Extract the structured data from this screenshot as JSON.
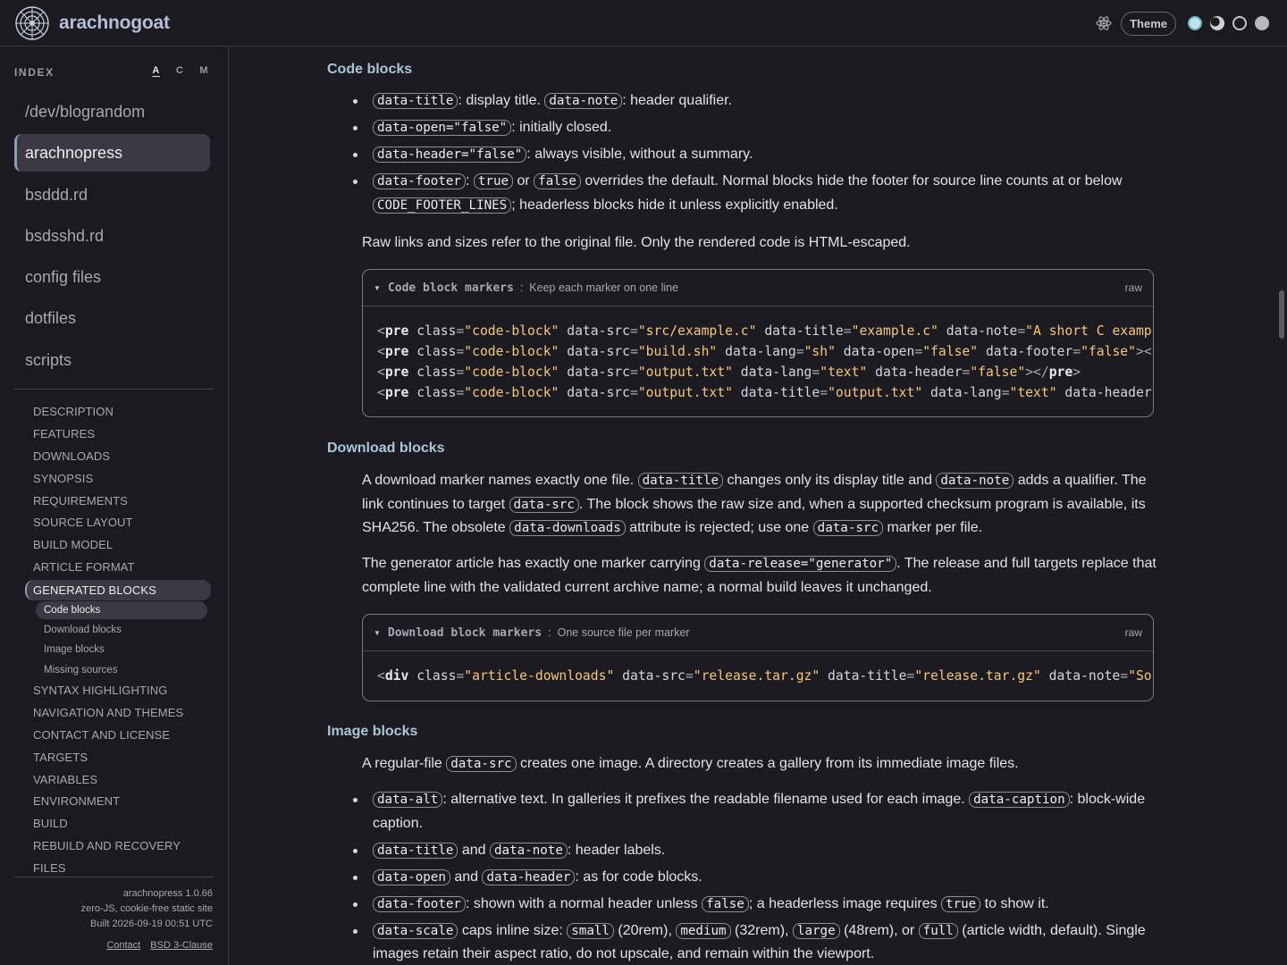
{
  "header": {
    "brand": "arachnogoat",
    "theme_label": "Theme",
    "icons": [
      "logo-icon",
      "atom-icon"
    ],
    "theme_dots": [
      "#b8e0e8",
      "#d8d8de",
      "#d8d8de",
      "#d8d8de"
    ]
  },
  "sidebar": {
    "index_label": "INDEX",
    "sort": [
      "A",
      "C",
      "M"
    ],
    "repos": [
      "/dev/blograndom",
      "arachnopress",
      "bsddd.rd",
      "bsdsshd.rd",
      "config files",
      "dotfiles",
      "scripts"
    ],
    "toc": {
      "t0": "DESCRIPTION",
      "t1": "FEATURES",
      "t2": "DOWNLOADS",
      "t3": "SYNOPSIS",
      "t4": "REQUIREMENTS",
      "t5": "SOURCE LAYOUT",
      "t6": "BUILD MODEL",
      "t7": "ARTICLE FORMAT",
      "t8": "GENERATED BLOCKS",
      "s0": "Code blocks",
      "s1": "Download blocks",
      "s2": "Image blocks",
      "s3": "Missing sources",
      "t9": "SYNTAX HIGHLIGHTING",
      "t10": "NAVIGATION AND THEMES",
      "t11": "CONTACT AND LICENSE",
      "t12": "TARGETS",
      "t13": "VARIABLES",
      "t14": "ENVIRONMENT",
      "t15": "BUILD",
      "t16": "REBUILD AND RECOVERY",
      "t17": "FILES"
    },
    "footer": {
      "version": "arachnopress 1.0.66",
      "tagline": "zero-JS, cookie-free static site",
      "built": "Built 2026-09-19 00:51 UTC",
      "contact": "Contact",
      "license": "BSD 3-Clause"
    }
  },
  "main": {
    "code_blocks": {
      "heading": "Code blocks",
      "raw_note": "Raw links and sizes refer to the original file. Only the rendered code is HTML-escaped.",
      "box_title": "Code block markers",
      "box_note": "Keep each marker on one line",
      "raw": "raw"
    },
    "download_blocks": {
      "heading": "Download blocks",
      "box_title": "Download block markers",
      "box_note": "One source file per marker",
      "raw": "raw"
    },
    "image_blocks": {
      "heading": "Image blocks"
    }
  }
}
